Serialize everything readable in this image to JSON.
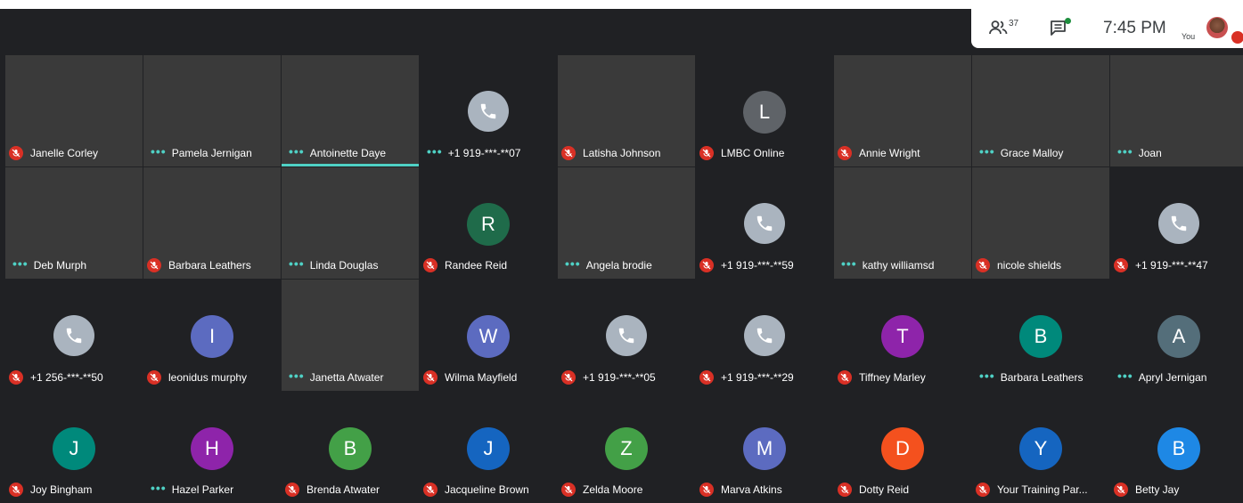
{
  "header": {
    "participant_count": "37",
    "time": "7:45 PM",
    "self_label": "You"
  },
  "colors": {
    "muted": "#d93025",
    "speaking_dots": "#4fd1c5",
    "phone_avatar": "#aab4bf"
  },
  "rows": [
    [
      {
        "name": "Janelle Corley",
        "type": "video",
        "status": "muted"
      },
      {
        "name": "Pamela Jernigan",
        "type": "video",
        "status": "dots"
      },
      {
        "name": "Antoinette Daye",
        "type": "video",
        "status": "dots"
      },
      {
        "name": "+1 919-***-**07",
        "type": "phone",
        "status": "dots"
      },
      {
        "name": "Latisha Johnson",
        "type": "video",
        "status": "muted"
      },
      {
        "name": "LMBC Online",
        "type": "letter",
        "letter": "L",
        "color": "#5f6368",
        "status": "muted"
      },
      {
        "name": "Annie Wright",
        "type": "video",
        "status": "muted"
      },
      {
        "name": "Grace Malloy",
        "type": "video",
        "status": "dots"
      },
      {
        "name": "Joan",
        "type": "video",
        "status": "dots"
      }
    ],
    [
      {
        "name": "Deb Murph",
        "type": "video",
        "status": "dots"
      },
      {
        "name": "Barbara Leathers",
        "type": "video",
        "status": "muted"
      },
      {
        "name": "Linda Douglas",
        "type": "video",
        "status": "dots"
      },
      {
        "name": "Randee Reid",
        "type": "letter",
        "letter": "R",
        "color": "#1f6b4a",
        "status": "muted"
      },
      {
        "name": "Angela brodie",
        "type": "video",
        "status": "dots"
      },
      {
        "name": "+1 919-***-**59",
        "type": "phone",
        "status": "muted"
      },
      {
        "name": "kathy williamsd",
        "type": "video",
        "status": "dots"
      },
      {
        "name": "nicole shields",
        "type": "video",
        "status": "muted"
      },
      {
        "name": "+1 919-***-**47",
        "type": "phone",
        "status": "muted"
      }
    ],
    [
      {
        "name": "+1 256-***-**50",
        "type": "phone",
        "status": "muted"
      },
      {
        "name": "leonidus murphy",
        "type": "letter",
        "letter": "I",
        "color": "#5c6bc0",
        "status": "muted"
      },
      {
        "name": "Janetta Atwater",
        "type": "video",
        "status": "dots"
      },
      {
        "name": "Wilma Mayfield",
        "type": "letter",
        "letter": "W",
        "color": "#5c6bc0",
        "status": "muted"
      },
      {
        "name": "+1 919-***-**05",
        "type": "phone",
        "status": "muted"
      },
      {
        "name": "+1 919-***-**29",
        "type": "phone",
        "status": "muted"
      },
      {
        "name": "Tiffney Marley",
        "type": "letter",
        "letter": "T",
        "color": "#8e24aa",
        "status": "muted"
      },
      {
        "name": "Barbara Leathers",
        "type": "letter",
        "letter": "B",
        "color": "#00897b",
        "status": "dots"
      },
      {
        "name": "Apryl Jernigan",
        "type": "letter",
        "letter": "A",
        "color": "#546e7a",
        "status": "dots"
      }
    ],
    [
      {
        "name": "Joy Bingham",
        "type": "letter",
        "letter": "J",
        "color": "#00897b",
        "status": "muted"
      },
      {
        "name": "Hazel Parker",
        "type": "letter",
        "letter": "H",
        "color": "#8e24aa",
        "status": "dots"
      },
      {
        "name": "Brenda Atwater",
        "type": "letter",
        "letter": "B",
        "color": "#43a047",
        "status": "muted"
      },
      {
        "name": "Jacqueline Brown",
        "type": "letter",
        "letter": "J",
        "color": "#1565c0",
        "status": "muted"
      },
      {
        "name": "Zelda Moore",
        "type": "letter",
        "letter": "Z",
        "color": "#43a047",
        "status": "muted"
      },
      {
        "name": "Marva Atkins",
        "type": "letter",
        "letter": "M",
        "color": "#5c6bc0",
        "status": "muted"
      },
      {
        "name": "Dotty Reid",
        "type": "letter",
        "letter": "D",
        "color": "#f4511e",
        "status": "muted"
      },
      {
        "name": "Your Training Par...",
        "type": "letter",
        "letter": "Y",
        "color": "#1565c0",
        "status": "muted"
      },
      {
        "name": "Betty Jay",
        "type": "letter",
        "letter": "B",
        "color": "#1e88e5",
        "status": "muted"
      }
    ]
  ]
}
